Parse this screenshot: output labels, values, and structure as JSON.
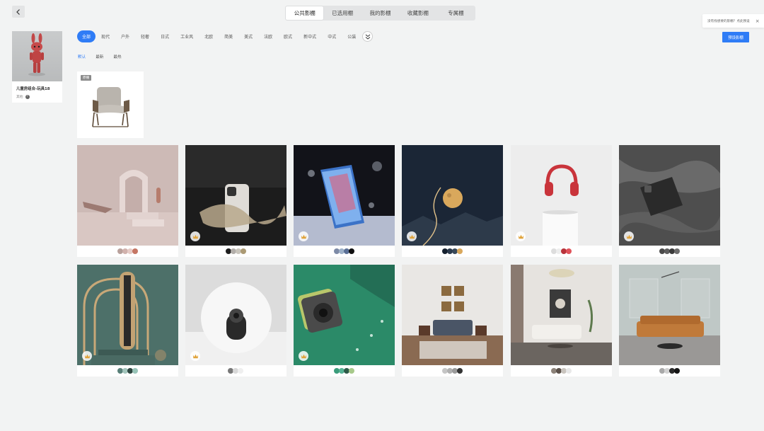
{
  "tabs": [
    "公共影棚",
    "已选用棚",
    "我的影棚",
    "收藏影棚",
    "专属棚"
  ],
  "active_tab": 0,
  "tip": {
    "text": "没有找想要的影棚？点此预设",
    "close": "×"
  },
  "model": {
    "name": "儿童房组合-玩具18",
    "category": "其他",
    "help": "?"
  },
  "styles": [
    "全部",
    "现代",
    "户外",
    "轻奢",
    "日式",
    "工业风",
    "北欧",
    "简美",
    "美式",
    "法欧",
    "欧式",
    "新中式",
    "中式",
    "公装"
  ],
  "active_style": 0,
  "preset_button": "预设影棚",
  "sorts": [
    "默认",
    "最新",
    "最热"
  ],
  "active_sort": 0,
  "current_badge": "原棚",
  "icons": {
    "back": "chevron-left-icon",
    "expand": "double-chevron-down-icon",
    "vip": "crown-icon",
    "help": "question-icon"
  },
  "colors": {
    "accent": "#2f7cf6",
    "background": "#f2f3f3"
  },
  "studios": [
    {
      "scene": "pink-arch",
      "vip": false,
      "palette": [
        "#b9a19c",
        "#d1b2ad",
        "#e7cdc8",
        "#c57664"
      ]
    },
    {
      "scene": "phone-silk",
      "vip": true,
      "palette": [
        "#1e1e1e",
        "#b2aeaa",
        "#c9c5bc",
        "#ab9a74"
      ]
    },
    {
      "scene": "phone-water",
      "vip": true,
      "palette": [
        "#7d8aa6",
        "#9db0c8",
        "#5a6f96",
        "#0f0f10"
      ]
    },
    {
      "scene": "moon",
      "vip": true,
      "palette": [
        "#15202e",
        "#2b3a4c",
        "#39495a",
        "#d9a85c"
      ]
    },
    {
      "scene": "headphones",
      "vip": true,
      "palette": [
        "#dddddd",
        "#eeeeee",
        "#b8323a",
        "#e0525a"
      ]
    },
    {
      "scene": "phone-satin",
      "vip": true,
      "palette": [
        "#4a4a4a",
        "#5e5e5e",
        "#3a3a3a",
        "#6d6d6d"
      ]
    },
    {
      "scene": "heater-arch",
      "vip": true,
      "palette": [
        "#587f78",
        "#a3c5bc",
        "#2e4640",
        "#98c4b8"
      ]
    },
    {
      "scene": "circle-light",
      "vip": true,
      "palette": [
        "#777777",
        "#d8d8d8",
        "#efefef"
      ]
    },
    {
      "scene": "camera-green",
      "vip": true,
      "palette": [
        "#3a9c7a",
        "#56b294",
        "#2d5a48",
        "#a7c98a"
      ]
    },
    {
      "scene": "living-classic",
      "vip": false,
      "palette": [
        "#c5c5c5",
        "#b0b0b0",
        "#9a9a9a",
        "#333333"
      ]
    },
    {
      "scene": "living-chandelier",
      "vip": false,
      "palette": [
        "#8c8279",
        "#5b514a",
        "#c9c4be",
        "#e8e8e8"
      ]
    },
    {
      "scene": "living-sofa",
      "vip": false,
      "palette": [
        "#a9a9a9",
        "#d2d2d2",
        "#2a2a2a",
        "#151515"
      ]
    }
  ]
}
